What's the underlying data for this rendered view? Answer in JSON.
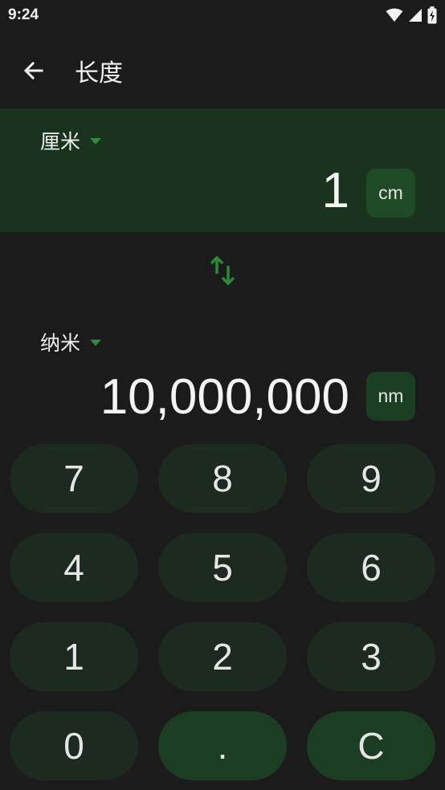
{
  "status": {
    "time": "9:24"
  },
  "app_bar": {
    "title": "长度"
  },
  "from": {
    "unit_name": "厘米",
    "value": "1",
    "unit_symbol": "cm"
  },
  "to": {
    "unit_name": "纳米",
    "value": "10,000,000",
    "unit_symbol": "nm"
  },
  "keypad": {
    "keys": [
      "7",
      "8",
      "9",
      "4",
      "5",
      "6",
      "1",
      "2",
      "3",
      "0",
      ".",
      "C"
    ]
  },
  "colors": {
    "background": "#1b1b1b",
    "from_panel": "#1a331f",
    "key": "#1d2a20",
    "key_accent": "#1b3d21",
    "accent_arrow": "#2e8b3c"
  }
}
